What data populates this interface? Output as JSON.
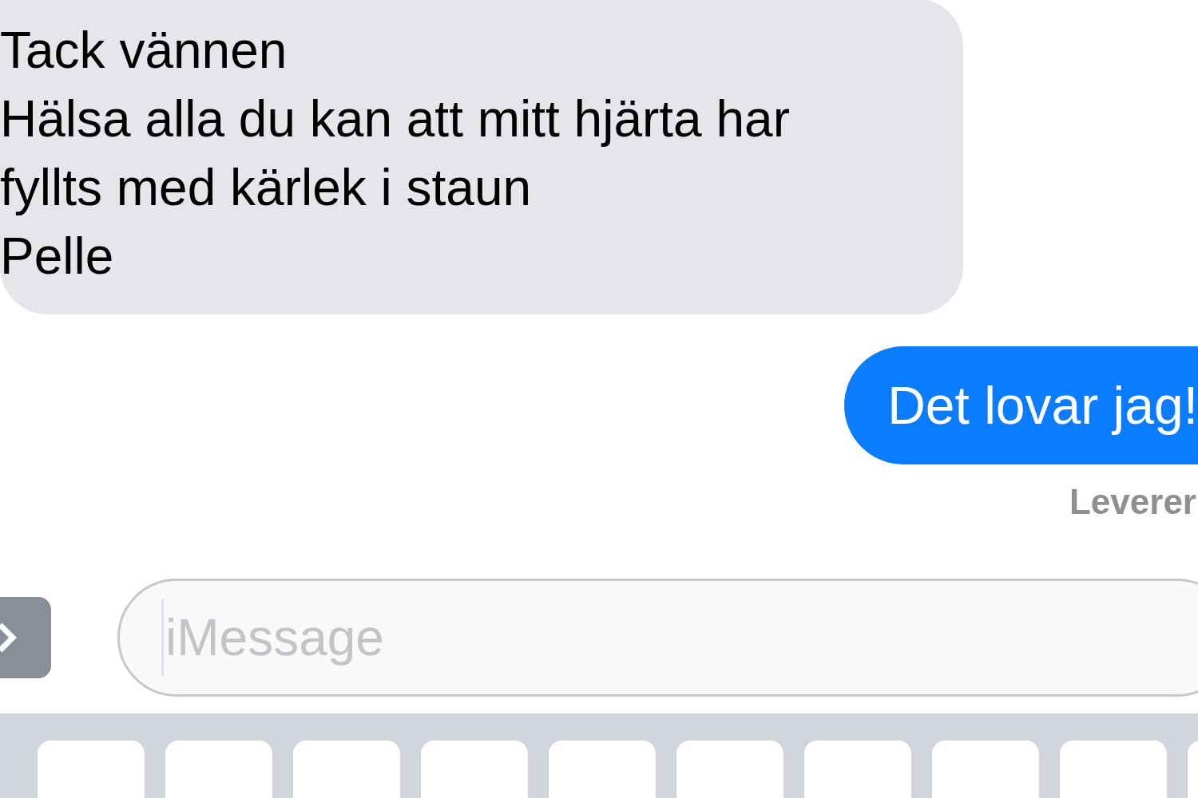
{
  "messages": [
    {
      "kind": "received",
      "lines": [
        "Tack vännen",
        "Hälsa alla du kan att mitt hjärta har",
        "fyllts med kärlek i staun",
        "Pelle"
      ]
    },
    {
      "kind": "sent",
      "lines": [
        "Det lovar jag!"
      ]
    }
  ],
  "delivery_status": "Leverer",
  "composer": {
    "placeholder": "iMessage"
  }
}
